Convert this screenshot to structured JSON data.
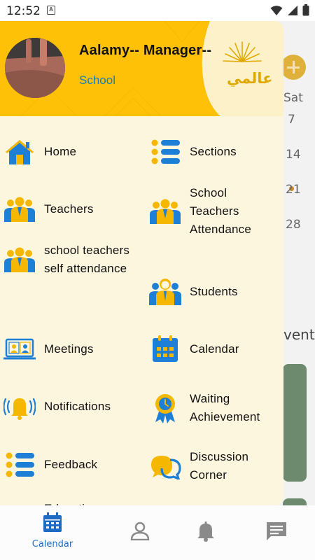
{
  "status_bar": {
    "time": "12:52",
    "notification_letter": "A"
  },
  "background": {
    "day_header": "Sat",
    "days": [
      "7",
      "14",
      "21",
      "28"
    ],
    "events_fragment": "vents"
  },
  "drawer": {
    "user_name": "Aalamy-- Manager--",
    "user_role": "School",
    "logo_text": "عالمي",
    "menu": [
      {
        "label": "Home",
        "icon": "home-icon"
      },
      {
        "label": "Sections",
        "icon": "list-icon"
      },
      {
        "label": "Teachers",
        "icon": "teachers-icon"
      },
      {
        "label": "School Teachers Attendance",
        "icon": "teachers-attendance-icon"
      },
      {
        "label": "school teachers self attendance",
        "icon": "self-attendance-icon"
      },
      {
        "label": "Students",
        "icon": "students-icon"
      },
      {
        "label": "Meetings",
        "icon": "video-meeting-icon"
      },
      {
        "label": "Calendar",
        "icon": "calendar-icon"
      },
      {
        "label": "Notifications",
        "icon": "bell-ringing-icon"
      },
      {
        "label": "Waiting Achievement",
        "icon": "award-ribbon-icon"
      },
      {
        "label": "Feedback",
        "icon": "feedback-list-icon"
      },
      {
        "label": "Discussion Corner",
        "icon": "chat-bubbles-icon"
      },
      {
        "label": "Education",
        "icon": "education-icon"
      }
    ]
  },
  "bottom_nav": {
    "items": [
      {
        "label": "Calendar",
        "icon": "calendar-icon",
        "active": true
      },
      {
        "label": "",
        "icon": "profile-icon",
        "active": false
      },
      {
        "label": "",
        "icon": "bell-icon",
        "active": false
      },
      {
        "label": "",
        "icon": "message-icon",
        "active": false
      }
    ]
  },
  "colors": {
    "accent_yellow": "#ffc107",
    "blue": "#1e7fd6",
    "drawer_bg": "#fdf6df",
    "active_nav": "#1e6cc2"
  }
}
